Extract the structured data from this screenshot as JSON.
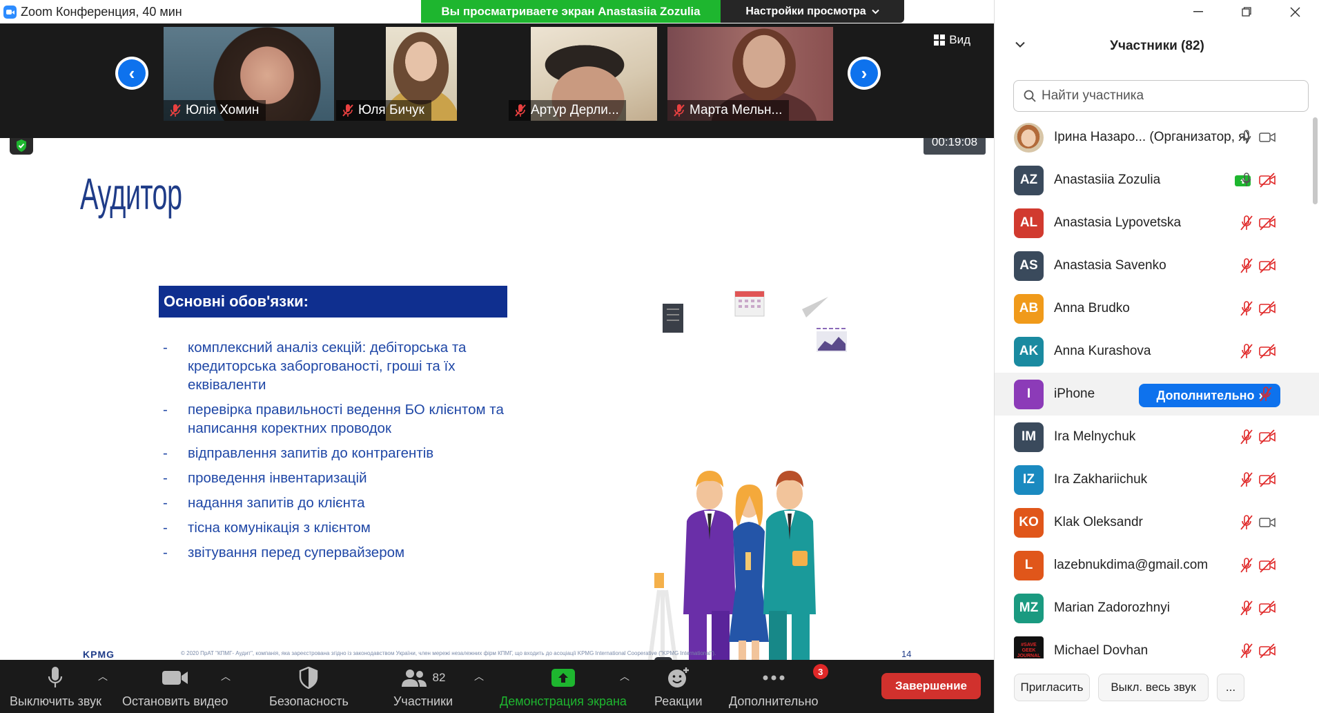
{
  "window": {
    "title": "Zoom Конференция, 40 мин"
  },
  "banner": {
    "viewing": "Вы просматриваете экран Anastasiia Zozulia",
    "view_options": "Настройки просмотра"
  },
  "strip": {
    "view_label": "Вид",
    "tiles": [
      {
        "name": "Юлія Хомин"
      },
      {
        "name": "Юля Бичук"
      },
      {
        "name": "Артур Дерли..."
      },
      {
        "name": "Марта Мельн..."
      }
    ]
  },
  "timer": "00:19:08",
  "slide": {
    "title": "Аудитор",
    "duties_heading": "Основні обов'язки:",
    "duties": [
      "комплексний аналіз секцій: дебіторська та кредиторська заборгованості, гроші та їх еквіваленти",
      "перевірка правильності ведення БО клієнтом та написання коректних проводок",
      "відправлення запитів до контрагентів",
      "проведення інвентаризацій",
      "надання запитів до клієнта",
      "тісна комунікація з клієнтом",
      "звітування перед супервайзером"
    ],
    "footer": "© 2020 ПрАТ \"КПМГ- Аудит\", компанія, яка зареєстрована згідно із законодавством України, член мережі незалежних фірм КПМГ, що входить до асоціації KPMG International Cooperative (\"KPMG International\").",
    "page": "14",
    "logo": "KPMG"
  },
  "toolbar": {
    "mute": "Выключить звук",
    "video": "Остановить видео",
    "security": "Безопасность",
    "participants": "Участники",
    "participants_count": "82",
    "share": "Демонстрация экрана",
    "reactions": "Реакции",
    "more": "Дополнительно",
    "more_badge": "3",
    "end": "Завершение"
  },
  "panel": {
    "title": "Участники (82)",
    "search_placeholder": "Найти участника",
    "more_button": "Дополнительно",
    "invite": "Пригласить",
    "mute_all": "Выкл. весь звук",
    "more_dots": "...",
    "participants": [
      {
        "initials": "",
        "name": "Ірина Назаро... (Организатор, я)",
        "color": "#c9a27e",
        "mic": "on",
        "video": "on",
        "photo": true
      },
      {
        "initials": "AZ",
        "name": "Anastasiia Zozulia",
        "color": "#3a4a5c",
        "mic": "on",
        "video": "off",
        "sharing": true
      },
      {
        "initials": "AL",
        "name": "Anastasia Lypovetska",
        "color": "#d13a2f",
        "mic": "off",
        "video": "off"
      },
      {
        "initials": "AS",
        "name": "Anastasia Savenko",
        "color": "#3a4a5c",
        "mic": "off",
        "video": "off"
      },
      {
        "initials": "AB",
        "name": "Anna Brudko",
        "color": "#f09a1a",
        "mic": "off",
        "video": "off"
      },
      {
        "initials": "AK",
        "name": "Anna Kurashova",
        "color": "#1a8aa0",
        "mic": "off",
        "video": "off"
      },
      {
        "initials": "I",
        "name": "iPhone",
        "color": "#8c3bb8",
        "mic": "off",
        "video": "none",
        "hover": true
      },
      {
        "initials": "IM",
        "name": "Ira Melnychuk",
        "color": "#3a4a5c",
        "mic": "off",
        "video": "off"
      },
      {
        "initials": "IZ",
        "name": "Ira Zakhariichuk",
        "color": "#1a8ac0",
        "mic": "off",
        "video": "off"
      },
      {
        "initials": "KO",
        "name": "Klak Oleksandr",
        "color": "#e0561a",
        "mic": "off",
        "video": "on"
      },
      {
        "initials": "L",
        "name": "lazebnukdima@gmail.com",
        "color": "#e0561a",
        "mic": "off",
        "video": "off"
      },
      {
        "initials": "MZ",
        "name": "Marian Zadorozhnyi",
        "color": "#1a9a80",
        "mic": "off",
        "video": "off"
      },
      {
        "initials": "",
        "name": "Michael Dovhan",
        "color": "#111111",
        "mic": "off",
        "video": "off",
        "geek": true
      }
    ]
  },
  "colors": {
    "accent": "#0e72ed",
    "green": "#1eb62f",
    "danger": "#d1312d",
    "slide_blue": "#1f47a6"
  }
}
